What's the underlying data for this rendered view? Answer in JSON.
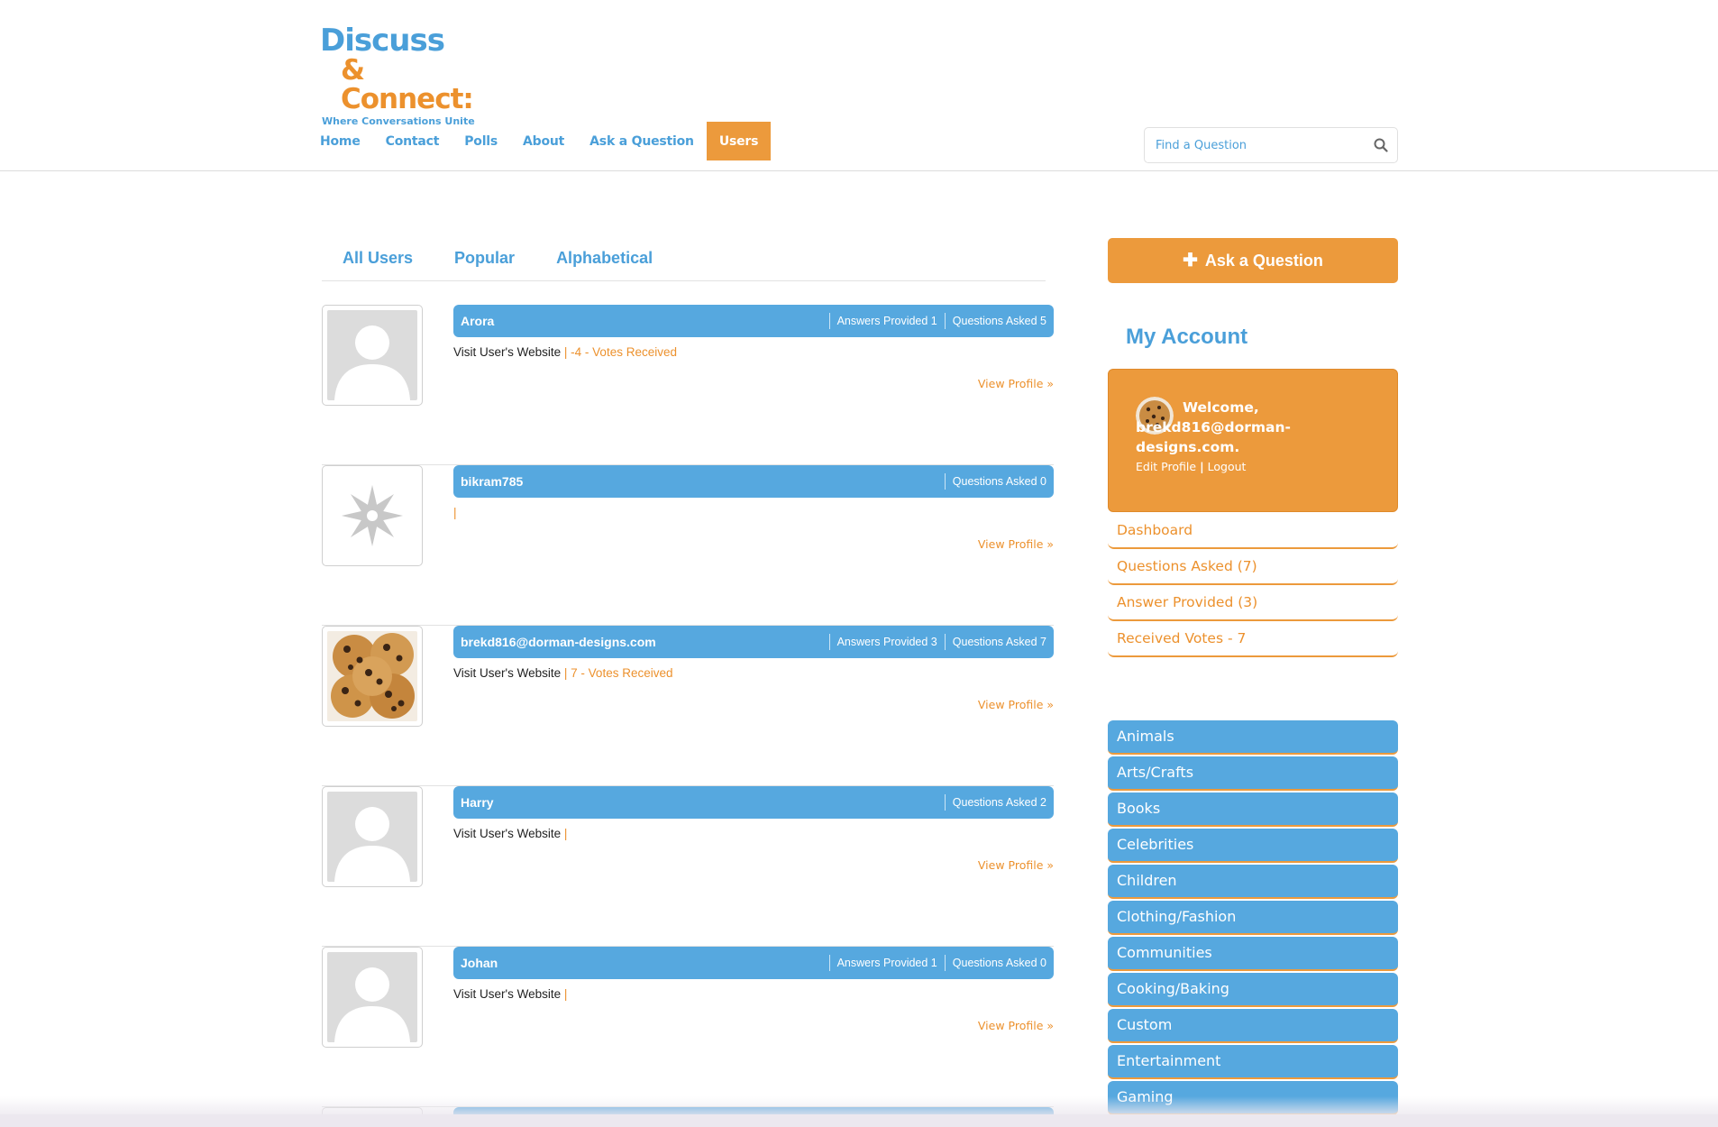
{
  "logo": {
    "line1": "Discuss",
    "line2": "& Connect:",
    "tagline": "Where Conversations Unite"
  },
  "nav": {
    "items": [
      "Home",
      "Contact",
      "Polls",
      "About",
      "Ask a Question",
      "Users"
    ],
    "active": "Users"
  },
  "search": {
    "placeholder": "Find a Question",
    "icon": "search-icon"
  },
  "tabs": [
    "All Users",
    "Popular",
    "Alphabetical"
  ],
  "users": [
    {
      "name": "Arora",
      "answers": "Answers Provided 1",
      "questions": "Questions Asked 5",
      "website": "Visit User's Website",
      "separator": "|",
      "votes": "-4 - Votes Received",
      "view": "View Profile »",
      "avatar": "default-person"
    },
    {
      "name": "bikram785",
      "answers": "",
      "questions": "Questions Asked 0",
      "website": "",
      "separator": "|",
      "votes": "",
      "view": "View Profile »",
      "avatar": "snowflake"
    },
    {
      "name": "brekd816@dorman-designs.com",
      "answers": "Answers Provided 3",
      "questions": "Questions Asked 7",
      "website": "Visit User's Website",
      "separator": "|",
      "votes": "7 - Votes Received",
      "view": "View Profile »",
      "avatar": "cookies"
    },
    {
      "name": "Harry",
      "answers": "",
      "questions": "Questions Asked 2",
      "website": "Visit User's Website",
      "separator": "|",
      "votes": "",
      "view": "View Profile »",
      "avatar": "default-person"
    },
    {
      "name": "Johan",
      "answers": "Answers Provided 1",
      "questions": "Questions Asked 0",
      "website": "Visit User's Website",
      "separator": "|",
      "votes": "",
      "view": "View Profile »",
      "avatar": "default-person"
    }
  ],
  "sidebar": {
    "ask_button": "Ask a Question",
    "my_account": "My Account",
    "welcome": "Welcome, brekd816@dorman-designs.com.",
    "edit_profile": "Edit Profile",
    "link_separator": "|",
    "logout": "Logout",
    "account_links": [
      "Dashboard",
      "Questions Asked (7)",
      "Answer Provided (3)",
      "Received Votes - 7"
    ],
    "categories": [
      "Animals",
      "Arts/Crafts",
      "Books",
      "Celebrities",
      "Children",
      "Clothing/Fashion",
      "Communities",
      "Cooking/Baking",
      "Custom",
      "Entertainment",
      "Gaming"
    ]
  },
  "colors": {
    "blue": "#56a8df",
    "orange": "#ec9a3c",
    "link_orange": "#ec912d"
  }
}
